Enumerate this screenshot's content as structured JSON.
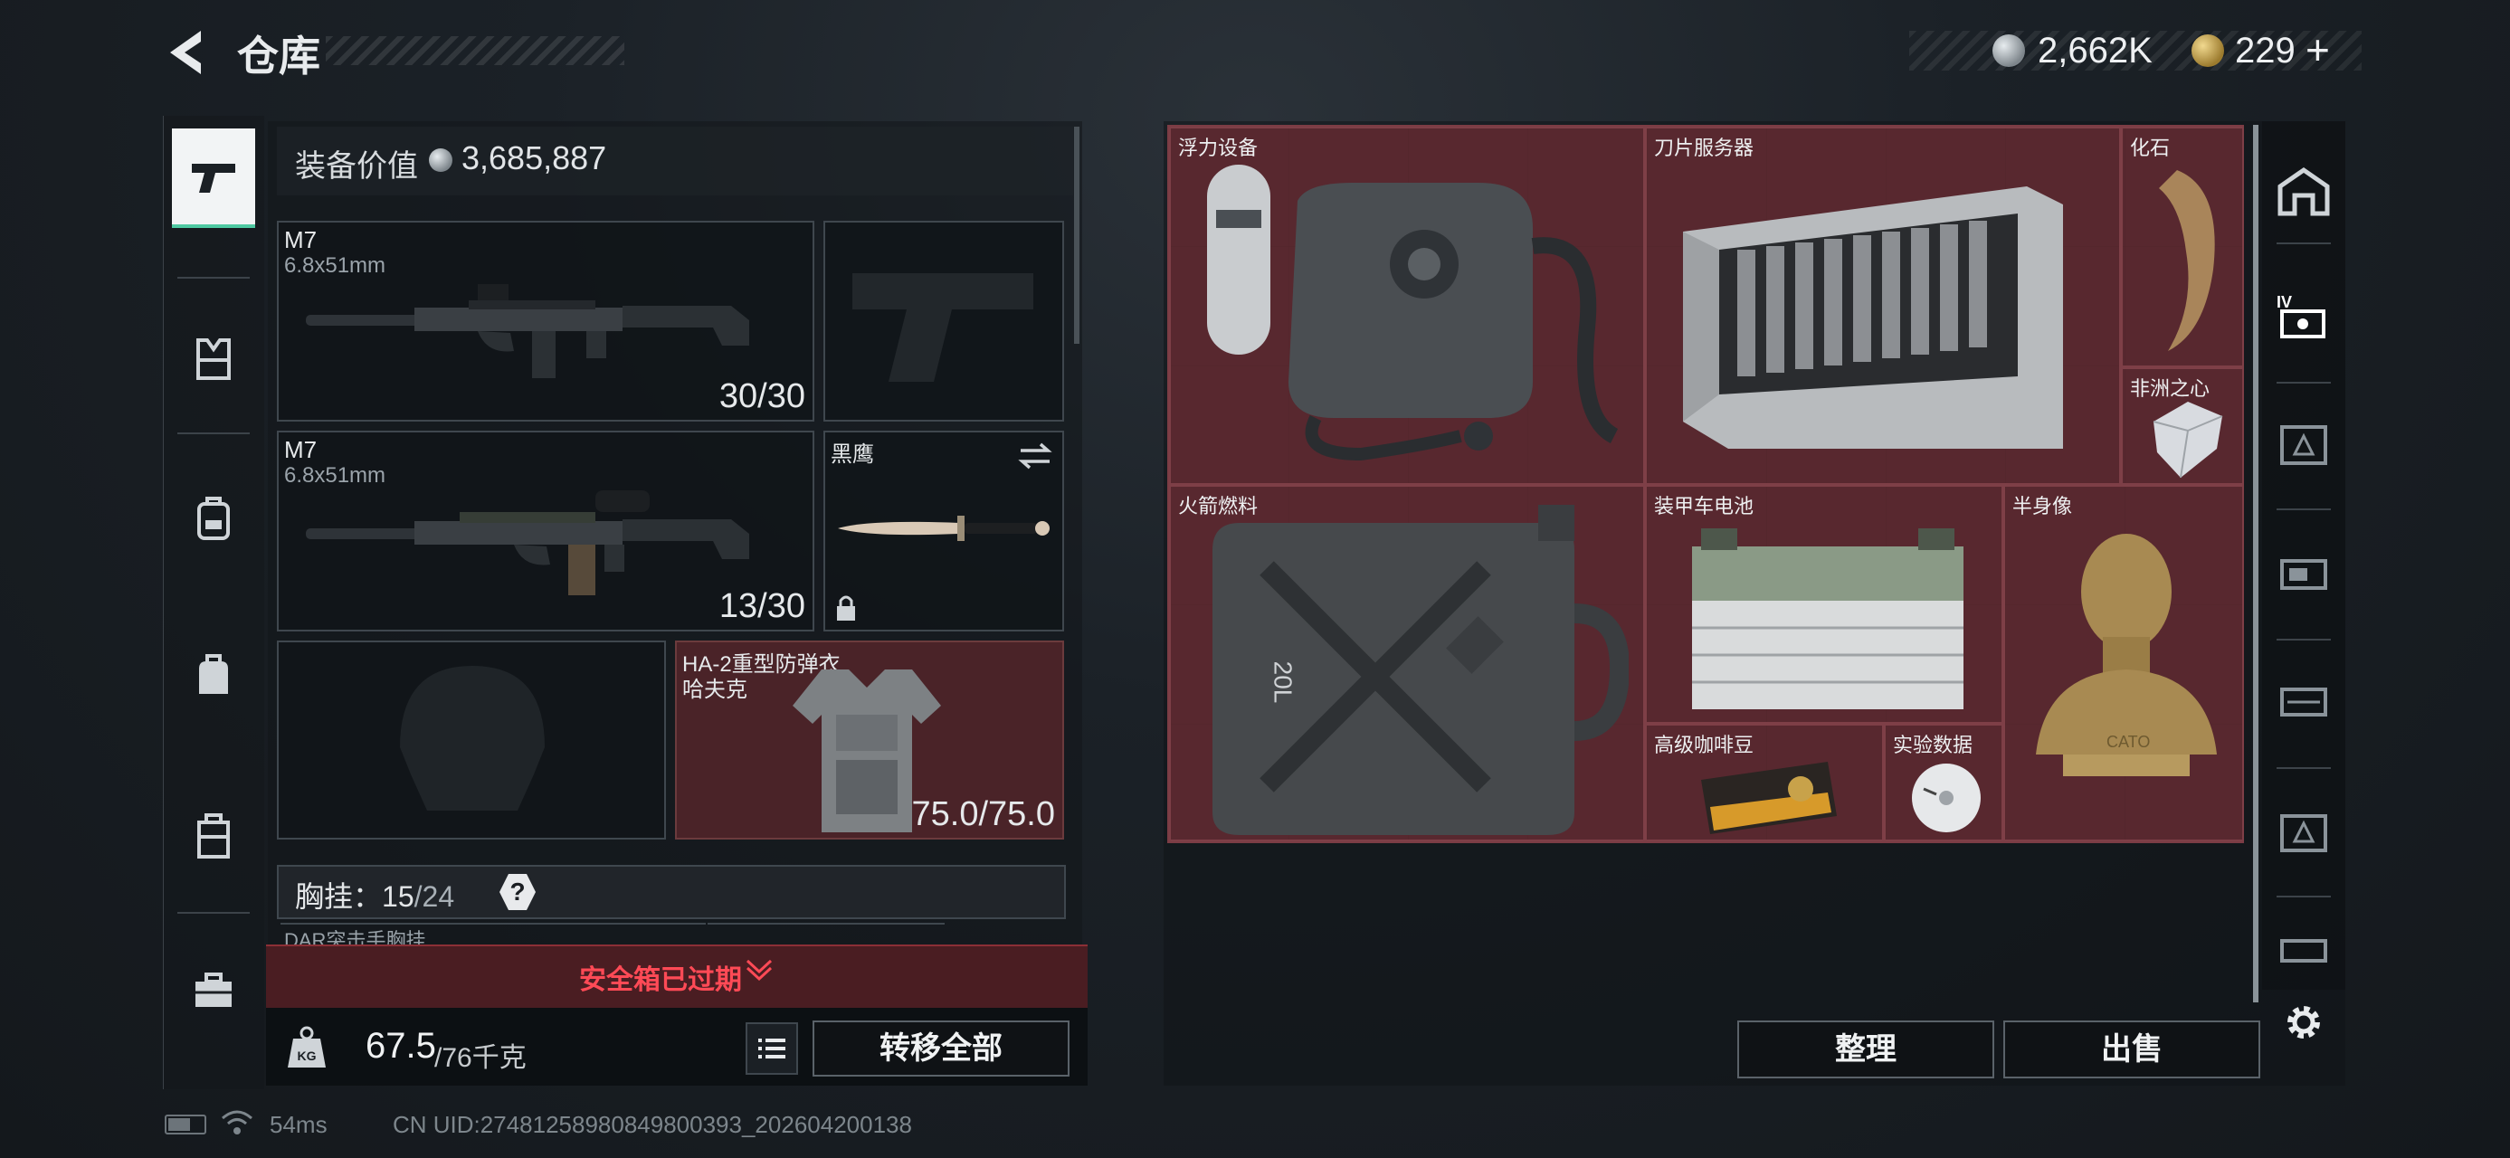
{
  "header": {
    "title": "仓库",
    "back_icon": "back-arrow-icon"
  },
  "currency": {
    "silver": {
      "value": "2,662K",
      "icon": "silver-coin-icon"
    },
    "gold": {
      "value": "229",
      "plus": "+",
      "icon": "gold-coin-icon"
    }
  },
  "left_rail": {
    "items": [
      {
        "name": "weapons",
        "icon": "pistol-icon",
        "active": true
      },
      {
        "name": "armor",
        "icon": "vest-icon",
        "active": false
      },
      {
        "name": "backpack",
        "icon": "backpack-icon",
        "active": false
      },
      {
        "name": "bag",
        "icon": "bag-icon",
        "active": false
      },
      {
        "name": "case",
        "icon": "case-icon",
        "active": false
      },
      {
        "name": "toolbox",
        "icon": "toolbox-icon",
        "active": false
      }
    ]
  },
  "equipment": {
    "label": "装备价值",
    "value": "3,685,887",
    "primary": {
      "name": "M7",
      "caliber": "6.8x51mm",
      "ammo": "30/30"
    },
    "secondary": {
      "name": "M7",
      "caliber": "6.8x51mm",
      "ammo": "13/30"
    },
    "melee": {
      "name": "黑鹰",
      "swap_icon": "swap-icon",
      "lock_icon": "lock-icon"
    },
    "armor": {
      "name": "HA-2重型防弹衣",
      "brand": "哈夫克",
      "durability": "75.0/75.0"
    },
    "vest": {
      "label": "胸挂",
      "sep": "：",
      "current": "15",
      "slash": "/",
      "capacity": "24",
      "help": "?",
      "sub_item": "DAR突击手胸挂"
    }
  },
  "safebox": {
    "text": "安全箱已过期",
    "icon": "chevron-down-icon"
  },
  "weight": {
    "value": "67.5",
    "capacity": "/76千克",
    "icon": "weight-kg-icon"
  },
  "actions": {
    "transfer_all": "转移全部",
    "sort": "整理",
    "sell": "出售",
    "list_icon": "list-icon",
    "settings_icon": "gear-icon"
  },
  "stash_items": [
    {
      "key": "float",
      "name": "浮力设备",
      "icon": "rebreather-icon"
    },
    {
      "key": "server",
      "name": "刀片服务器",
      "icon": "blade-server-icon"
    },
    {
      "key": "fossil",
      "name": "化石",
      "icon": "fossil-claw-icon"
    },
    {
      "key": "heart",
      "name": "非洲之心",
      "icon": "diamond-icon"
    },
    {
      "key": "fuel",
      "name": "火箭燃料",
      "icon": "jerrycan-icon",
      "label": "20L"
    },
    {
      "key": "battery",
      "name": "装甲车电池",
      "icon": "battery-icon"
    },
    {
      "key": "bust",
      "name": "半身像",
      "icon": "bust-icon",
      "label": "CATO"
    },
    {
      "key": "coffee",
      "name": "高级咖啡豆",
      "icon": "coffee-bag-icon"
    },
    {
      "key": "data",
      "name": "实验数据",
      "icon": "disc-icon"
    }
  ],
  "right_rail": {
    "items": [
      {
        "icon": "home-icon"
      },
      {
        "icon": "tier4-icon",
        "active": true
      },
      {
        "icon": "tier3-icon"
      },
      {
        "icon": "tier3b-icon"
      },
      {
        "icon": "tier3c-icon"
      },
      {
        "icon": "tier2-icon"
      },
      {
        "icon": "tier1-icon"
      }
    ]
  },
  "status": {
    "ping": "54ms",
    "uid": "CN UID:27481258980849800393_202604200138",
    "battery_icon": "battery-status-icon",
    "wifi_icon": "wifi-icon"
  }
}
